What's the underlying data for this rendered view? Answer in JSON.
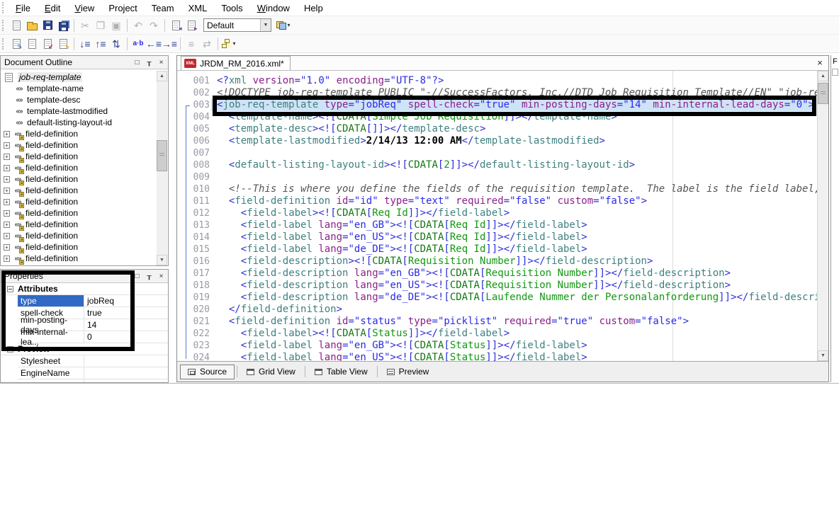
{
  "colors": {
    "selection_blue": "#316ac5",
    "row_highlight_blue": "#cfe3f6",
    "annotation_black": "#000000",
    "tag_teal": "#3f8080",
    "attribute_purple": "#8a1f8a",
    "value_blue": "#2a2ae8",
    "cdata_green": "#119911",
    "comment_gray": "#555555",
    "xml_tab_icon_red": "#c0282d"
  },
  "menu": {
    "items": [
      {
        "label": "File",
        "u": 0
      },
      {
        "label": "Edit",
        "u": 0
      },
      {
        "label": "View",
        "u": 0
      },
      {
        "label": "Project",
        "u": -1
      },
      {
        "label": "Team",
        "u": -1
      },
      {
        "label": "XML",
        "u": -1
      },
      {
        "label": "Tools",
        "u": -1
      },
      {
        "label": "Window",
        "u": 0
      },
      {
        "label": "Help",
        "u": -1
      }
    ]
  },
  "toolbars": {
    "row1": [
      {
        "t": "icon",
        "name": "new-document-icon",
        "shape": "page"
      },
      {
        "t": "icon",
        "name": "open-folder-icon",
        "shape": "folder"
      },
      {
        "t": "icon",
        "name": "save-icon",
        "shape": "floppy"
      },
      {
        "t": "icon",
        "name": "save-all-icon",
        "shape": "floppy-all"
      },
      {
        "t": "sep"
      },
      {
        "t": "icon",
        "name": "cut-icon",
        "glyph": "✂",
        "disabled": true
      },
      {
        "t": "icon",
        "name": "copy-icon",
        "glyph": "❐",
        "disabled": true
      },
      {
        "t": "icon",
        "name": "paste-icon",
        "glyph": "▣",
        "disabled": true
      },
      {
        "t": "sep"
      },
      {
        "t": "icon",
        "name": "undo-icon",
        "glyph": "↶",
        "disabled": true
      },
      {
        "t": "icon",
        "name": "redo-icon",
        "glyph": "↷",
        "disabled": true
      },
      {
        "t": "sep"
      },
      {
        "t": "icon",
        "name": "previous-editor-icon",
        "shape": "page-prev",
        "badge": "◂",
        "badge_color": "#7a3fa0"
      },
      {
        "t": "icon",
        "name": "next-editor-icon",
        "shape": "page-next",
        "badge": "▸",
        "badge_color": "#7a3fa0"
      },
      {
        "t": "combo",
        "name": "style-combo",
        "value": "Default"
      },
      {
        "t": "icon",
        "name": "team-synchronize-icon",
        "shape": "sync",
        "dropdown": true
      }
    ],
    "row2": [
      {
        "t": "icon",
        "name": "validate-document-icon",
        "shape": "page-edit",
        "badge": "✎",
        "badge_color": "#2a50c0"
      },
      {
        "t": "icon",
        "name": "format-document-icon",
        "shape": "page-plain"
      },
      {
        "t": "icon",
        "name": "check-document-icon",
        "shape": "page-check",
        "badge": "✔",
        "badge_color": "#c02020"
      },
      {
        "t": "icon",
        "name": "run-validation-icon",
        "shape": "page-flash",
        "badge": "ϟ",
        "badge_color": "#d8a400"
      },
      {
        "t": "sep"
      },
      {
        "t": "icon",
        "name": "sort-descending-icon",
        "glyph": "↓≡",
        "color": "#33418f"
      },
      {
        "t": "icon",
        "name": "sort-ascending-icon",
        "glyph": "↑≡",
        "color": "#33418f"
      },
      {
        "t": "icon",
        "name": "expand-collapse-icon",
        "glyph": "⇅",
        "color": "#33418f"
      },
      {
        "t": "sep"
      },
      {
        "t": "icon",
        "name": "find-replace-icon",
        "glyph": "a·b",
        "color": "#2a2ae0",
        "text": true
      },
      {
        "t": "icon",
        "name": "shift-left-icon",
        "glyph": "←≡",
        "color": "#33418f"
      },
      {
        "t": "icon",
        "name": "shift-right-icon",
        "glyph": "→≡",
        "color": "#33418f"
      },
      {
        "t": "sep"
      },
      {
        "t": "icon",
        "name": "justify-icon",
        "glyph": "≡",
        "disabled": true
      },
      {
        "t": "icon",
        "name": "clear-format-icon",
        "glyph": "⇄",
        "disabled": true
      },
      {
        "t": "sep"
      },
      {
        "t": "icon",
        "name": "new-xml-wizard-icon",
        "shape": "sitemap",
        "dropdown": true
      }
    ]
  },
  "outline": {
    "title": "Document Outline",
    "buttons": {
      "maximize": "□",
      "pin": "┰",
      "close": "×"
    },
    "expander_glyph": "+",
    "element_icon_glyph": "«»",
    "attr_badge_glyph": "a",
    "root": "job-req-template",
    "items": [
      "template-name",
      "template-desc",
      "template-lastmodified",
      "default-listing-layout-id"
    ],
    "field_item_label": "field-definition",
    "field_item_count": 13
  },
  "properties": {
    "title": "Properties",
    "buttons": {
      "maximize": "□",
      "pin": "┰",
      "close": "×"
    },
    "sections": [
      {
        "label": "Attributes",
        "rows": [
          {
            "name": "type",
            "value": "jobReq",
            "selected": true
          },
          {
            "name": "spell-check",
            "value": "true"
          },
          {
            "name": "min-posting-days",
            "value": "14"
          },
          {
            "name": "min-internal-lea...",
            "value": "0"
          }
        ]
      },
      {
        "label": "Preview",
        "rows": [
          {
            "name": "Stylesheet",
            "value": ""
          },
          {
            "name": "EngineName",
            "value": ""
          },
          {
            "name": "",
            "value": ""
          }
        ]
      }
    ]
  },
  "editor": {
    "tab": "JRDM_RM_2016.xml*",
    "tab_icon_label": "XML",
    "close_label": "×",
    "right_strip_label": "F",
    "lines": [
      {
        "n": "001",
        "s": "<?xml version=\"1.0\" encoding=\"UTF-8\"?>"
      },
      {
        "n": "002",
        "s": "<!DOCTYPE job-req-template PUBLIC \"-//SuccessFactors, Inc.//DTD Job Requisition Template//EN\" \"job-req-te"
      },
      {
        "n": "003",
        "s": "<job-req-template type=\"jobReq\" spell-check=\"true\" min-posting-days=\"14\" min-internal-lead-days=\"0\">",
        "hl": true
      },
      {
        "n": "004",
        "s": "  <template-name><![CDATA[Simple Job Requisition]]></template-name>"
      },
      {
        "n": "005",
        "s": "  <template-desc><![CDATA[]]></template-desc>"
      },
      {
        "n": "006",
        "s": "  <template-lastmodified>2/14/13 12:00 AM</template-lastmodified>"
      },
      {
        "n": "007",
        "s": ""
      },
      {
        "n": "008",
        "s": "  <default-listing-layout-id><![CDATA[2]]></default-listing-layout-id>"
      },
      {
        "n": "009",
        "s": ""
      },
      {
        "n": "010",
        "s": "  <!--This is where you define the fields of the requisition template.  The label is the field label, the"
      },
      {
        "n": "011",
        "s": "  <field-definition id=\"id\" type=\"text\" required=\"false\" custom=\"false\">"
      },
      {
        "n": "012",
        "s": "    <field-label><![CDATA[Req Id]]></field-label>"
      },
      {
        "n": "013",
        "s": "    <field-label lang=\"en_GB\"><![CDATA[Req Id]]></field-label>"
      },
      {
        "n": "014",
        "s": "    <field-label lang=\"en_US\"><![CDATA[Req Id]]></field-label>"
      },
      {
        "n": "015",
        "s": "    <field-label lang=\"de_DE\"><![CDATA[Req Id]]></field-label>"
      },
      {
        "n": "016",
        "s": "    <field-description><![CDATA[Requisition Number]]></field-description>"
      },
      {
        "n": "017",
        "s": "    <field-description lang=\"en_GB\"><![CDATA[Requisition Number]]></field-description>"
      },
      {
        "n": "018",
        "s": "    <field-description lang=\"en_US\"><![CDATA[Requisition Number]]></field-description>"
      },
      {
        "n": "019",
        "s": "    <field-description lang=\"de_DE\"><![CDATA[Laufende Nummer der Personalanforderung]]></field-descriptio"
      },
      {
        "n": "020",
        "s": "  </field-definition>"
      },
      {
        "n": "021",
        "s": "  <field-definition id=\"status\" type=\"picklist\" required=\"true\" custom=\"false\">"
      },
      {
        "n": "022",
        "s": "    <field-label><![CDATA[Status]]></field-label>"
      },
      {
        "n": "023",
        "s": "    <field-label lang=\"en_GB\"><![CDATA[Status]]></field-label>"
      },
      {
        "n": "024",
        "s": "    <field-label lang=\"en_US\"><![CDATA[Status]]></field-label>"
      }
    ],
    "view_tabs": [
      {
        "label": "Source",
        "icon": "source",
        "active": true
      },
      {
        "label": "Grid View",
        "icon": "grid",
        "active": false
      },
      {
        "label": "Table View",
        "icon": "table",
        "active": false
      },
      {
        "label": "Preview",
        "icon": "preview",
        "active": false
      }
    ]
  }
}
